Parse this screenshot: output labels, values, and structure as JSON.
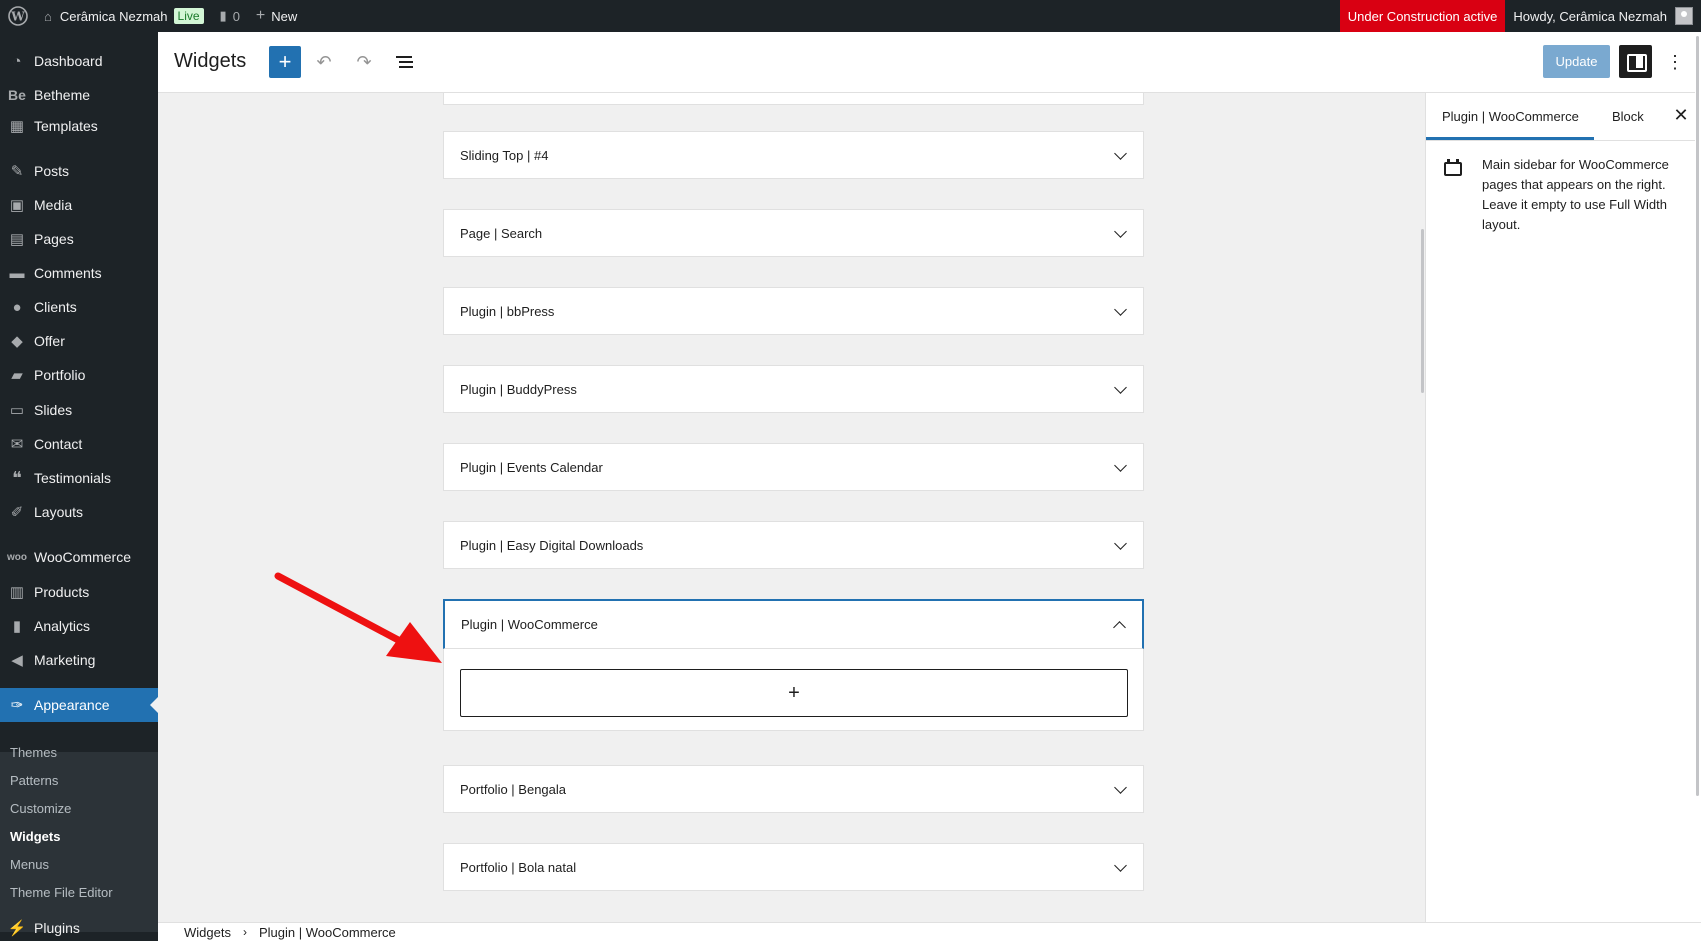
{
  "admin_bar": {
    "site_name": "Cerâmica Nezmah",
    "live_badge": "Live",
    "comments_count": "0",
    "new_label": "New",
    "under_construction": "Under Construction active",
    "howdy": "Howdy, Cerâmica Nezmah"
  },
  "sidebar": {
    "items": [
      {
        "label": "Dashboard",
        "icon": "gauge-icon"
      },
      {
        "label": "Betheme",
        "icon": "be-icon"
      },
      {
        "label": "Templates",
        "icon": "templates-icon"
      },
      {
        "label": "Posts",
        "icon": "pin-icon"
      },
      {
        "label": "Media",
        "icon": "media-icon"
      },
      {
        "label": "Pages",
        "icon": "pages-icon"
      },
      {
        "label": "Comments",
        "icon": "comment-icon"
      },
      {
        "label": "Clients",
        "icon": "clients-icon"
      },
      {
        "label": "Offer",
        "icon": "tag-icon"
      },
      {
        "label": "Portfolio",
        "icon": "folder-icon"
      },
      {
        "label": "Slides",
        "icon": "slides-icon"
      },
      {
        "label": "Contact",
        "icon": "mail-icon"
      },
      {
        "label": "Testimonials",
        "icon": "quote-icon"
      },
      {
        "label": "Layouts",
        "icon": "brush-icon"
      },
      {
        "label": "WooCommerce",
        "icon": "woo-icon"
      },
      {
        "label": "Products",
        "icon": "archive-icon"
      },
      {
        "label": "Analytics",
        "icon": "chart-icon"
      },
      {
        "label": "Marketing",
        "icon": "megaphone-icon"
      },
      {
        "label": "Appearance",
        "icon": "paint-icon"
      },
      {
        "label": "Plugins",
        "icon": "plugin-icon"
      }
    ],
    "submenu": [
      "Themes",
      "Patterns",
      "Customize",
      "Widgets",
      "Menus",
      "Theme File Editor"
    ]
  },
  "header": {
    "title": "Widgets",
    "add_label": "+",
    "update_label": "Update"
  },
  "widget_areas": [
    {
      "label": "Sliding Top | #4"
    },
    {
      "label": "Page | Search"
    },
    {
      "label": "Plugin | bbPress"
    },
    {
      "label": "Plugin | BuddyPress"
    },
    {
      "label": "Plugin | Events Calendar"
    },
    {
      "label": "Plugin | Easy Digital Downloads"
    },
    {
      "label": "Plugin | WooCommerce"
    },
    {
      "label": "Portfolio | Bengala"
    },
    {
      "label": "Portfolio | Bola natal"
    }
  ],
  "appender_label": "+",
  "inspector": {
    "tab_area": "Plugin | WooCommerce",
    "tab_block": "Block",
    "close": "✕",
    "description": "Main sidebar for WooCommerce pages that appears on the right. Leave it empty to use Full Width layout."
  },
  "breadcrumb": {
    "root": "Widgets",
    "current": "Plugin | WooCommerce"
  },
  "colors": {
    "admin_dark": "#1d2327",
    "accent": "#2271b1",
    "warning_red": "#d90012"
  }
}
